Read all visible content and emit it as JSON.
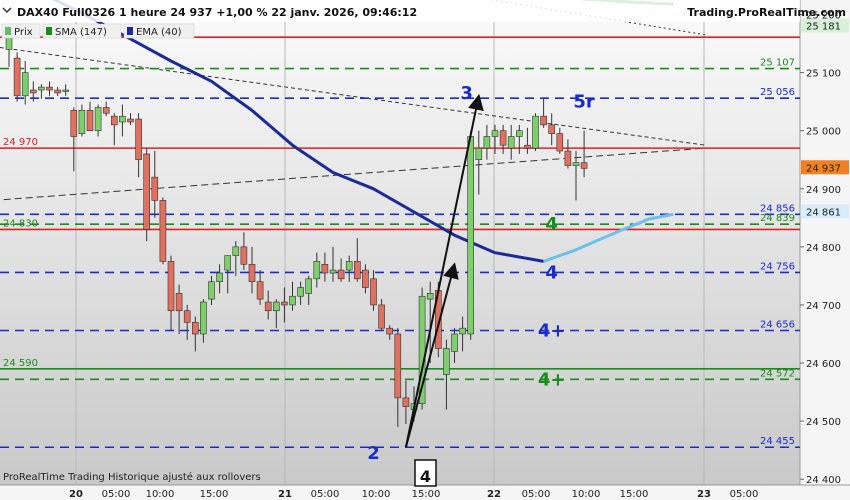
{
  "header": {
    "title": "DAX40 Full0326 1 heure 24 937 +1,00 % 22 janv. 2026, 09:46:12",
    "brand": "Trading.ProRealTime.com"
  },
  "legend": [
    {
      "label": "Prix",
      "color": "#66bb66"
    },
    {
      "label": "SMA (147)",
      "color": "#1a8c1a"
    },
    {
      "label": "EMA (40)",
      "color": "#1a2a99"
    }
  ],
  "footer": {
    "text": "ProRealTime Trading  Historique ajusté aux rollovers",
    "box_label": "4"
  },
  "chart_data": {
    "type": "candlestick",
    "timeframe": "1 heure",
    "ylim": [
      24390,
      25225
    ],
    "y_ticks": [
      "25 200",
      "25 100",
      "25 000",
      "24 900",
      "24 800",
      "24 700",
      "24 600",
      "24 500",
      "24 400"
    ],
    "y_tick_values": [
      25200,
      25100,
      25000,
      24900,
      24800,
      24700,
      24600,
      24500,
      24400
    ],
    "x_ticks": [
      "20",
      "05:00",
      "10:00",
      "15:00",
      "21",
      "05:00",
      "10:00",
      "15:00",
      "22",
      "05:00",
      "10:00",
      "15:00",
      "23",
      "05:00"
    ],
    "x_tick_bold": [
      true,
      false,
      false,
      false,
      true,
      false,
      false,
      false,
      true,
      false,
      false,
      false,
      true,
      false
    ],
    "candles": [
      {
        "o": 25140,
        "h": 25170,
        "l": 25110,
        "c": 25160
      },
      {
        "o": 25125,
        "h": 25135,
        "l": 25050,
        "c": 25060
      },
      {
        "o": 25060,
        "h": 25120,
        "l": 25045,
        "c": 25100
      },
      {
        "o": 25070,
        "h": 25085,
        "l": 25050,
        "c": 25065
      },
      {
        "o": 25070,
        "h": 25080,
        "l": 25055,
        "c": 25075
      },
      {
        "o": 25075,
        "h": 25085,
        "l": 25060,
        "c": 25070
      },
      {
        "o": 25070,
        "h": 25075,
        "l": 25060,
        "c": 25065
      },
      {
        "o": 25070,
        "h": 25080,
        "l": 25060,
        "c": 25070
      },
      {
        "o": 25035,
        "h": 25040,
        "l": 24930,
        "c": 24990
      },
      {
        "o": 24995,
        "h": 25045,
        "l": 24990,
        "c": 25035
      },
      {
        "o": 25035,
        "h": 25050,
        "l": 25000,
        "c": 25000
      },
      {
        "o": 25000,
        "h": 25045,
        "l": 24990,
        "c": 25040
      },
      {
        "o": 25040,
        "h": 25050,
        "l": 25025,
        "c": 25030
      },
      {
        "o": 25025,
        "h": 25030,
        "l": 24975,
        "c": 25010
      },
      {
        "o": 25015,
        "h": 25045,
        "l": 24990,
        "c": 25025
      },
      {
        "o": 25020,
        "h": 25030,
        "l": 25010,
        "c": 25015
      },
      {
        "o": 25020,
        "h": 25030,
        "l": 24920,
        "c": 24950
      },
      {
        "o": 24960,
        "h": 24970,
        "l": 24810,
        "c": 24830
      },
      {
        "o": 24920,
        "h": 24965,
        "l": 24850,
        "c": 24880
      },
      {
        "o": 24880,
        "h": 24885,
        "l": 24770,
        "c": 24775
      },
      {
        "o": 24775,
        "h": 24785,
        "l": 24655,
        "c": 24690
      },
      {
        "o": 24720,
        "h": 24735,
        "l": 24650,
        "c": 24690
      },
      {
        "o": 24690,
        "h": 24700,
        "l": 24640,
        "c": 24670
      },
      {
        "o": 24670,
        "h": 24680,
        "l": 24620,
        "c": 24650
      },
      {
        "o": 24650,
        "h": 24710,
        "l": 24635,
        "c": 24705
      },
      {
        "o": 24710,
        "h": 24750,
        "l": 24700,
        "c": 24740
      },
      {
        "o": 24740,
        "h": 24770,
        "l": 24720,
        "c": 24755
      },
      {
        "o": 24760,
        "h": 24785,
        "l": 24720,
        "c": 24785
      },
      {
        "o": 24785,
        "h": 24810,
        "l": 24750,
        "c": 24800
      },
      {
        "o": 24800,
        "h": 24825,
        "l": 24760,
        "c": 24770
      },
      {
        "o": 24770,
        "h": 24800,
        "l": 24720,
        "c": 24740
      },
      {
        "o": 24740,
        "h": 24760,
        "l": 24700,
        "c": 24710
      },
      {
        "o": 24705,
        "h": 24725,
        "l": 24675,
        "c": 24690
      },
      {
        "o": 24690,
        "h": 24710,
        "l": 24660,
        "c": 24705
      },
      {
        "o": 24705,
        "h": 24730,
        "l": 24670,
        "c": 24700
      },
      {
        "o": 24700,
        "h": 24740,
        "l": 24690,
        "c": 24715
      },
      {
        "o": 24715,
        "h": 24740,
        "l": 24700,
        "c": 24730
      },
      {
        "o": 24720,
        "h": 24750,
        "l": 24700,
        "c": 24745
      },
      {
        "o": 24745,
        "h": 24790,
        "l": 24730,
        "c": 24775
      },
      {
        "o": 24770,
        "h": 24790,
        "l": 24740,
        "c": 24755
      },
      {
        "o": 24755,
        "h": 24800,
        "l": 24740,
        "c": 24760
      },
      {
        "o": 24760,
        "h": 24780,
        "l": 24740,
        "c": 24745
      },
      {
        "o": 24760,
        "h": 24785,
        "l": 24740,
        "c": 24775
      },
      {
        "o": 24775,
        "h": 24815,
        "l": 24740,
        "c": 24745
      },
      {
        "o": 24760,
        "h": 24770,
        "l": 24720,
        "c": 24730
      },
      {
        "o": 24745,
        "h": 24760,
        "l": 24690,
        "c": 24700
      },
      {
        "o": 24700,
        "h": 24710,
        "l": 24655,
        "c": 24660
      },
      {
        "o": 24660,
        "h": 24665,
        "l": 24640,
        "c": 24650
      },
      {
        "o": 24650,
        "h": 24660,
        "l": 24490,
        "c": 24540
      },
      {
        "o": 24540,
        "h": 24570,
        "l": 24495,
        "c": 24525
      },
      {
        "o": 24520,
        "h": 24560,
        "l": 24500,
        "c": 24530
      },
      {
        "o": 24530,
        "h": 24730,
        "l": 24520,
        "c": 24715
      },
      {
        "o": 24710,
        "h": 24740,
        "l": 24600,
        "c": 24720
      },
      {
        "o": 24725,
        "h": 24740,
        "l": 24610,
        "c": 24625
      },
      {
        "o": 24580,
        "h": 24640,
        "l": 24520,
        "c": 24625
      },
      {
        "o": 24620,
        "h": 24660,
        "l": 24600,
        "c": 24650
      },
      {
        "o": 24650,
        "h": 24680,
        "l": 24620,
        "c": 24660
      },
      {
        "o": 24650,
        "h": 25000,
        "l": 24640,
        "c": 24990
      },
      {
        "o": 24950,
        "h": 25000,
        "l": 24890,
        "c": 24970
      },
      {
        "o": 24970,
        "h": 25010,
        "l": 24950,
        "c": 24990
      },
      {
        "o": 24990,
        "h": 25010,
        "l": 24960,
        "c": 25000
      },
      {
        "o": 25000,
        "h": 25010,
        "l": 24960,
        "c": 24975
      },
      {
        "o": 24970,
        "h": 25010,
        "l": 24950,
        "c": 24990
      },
      {
        "o": 24990,
        "h": 25010,
        "l": 24960,
        "c": 25000
      },
      {
        "o": 24975,
        "h": 25005,
        "l": 24960,
        "c": 24970
      },
      {
        "o": 24970,
        "h": 25030,
        "l": 24965,
        "c": 25025
      },
      {
        "o": 25025,
        "h": 25055,
        "l": 25005,
        "c": 25010
      },
      {
        "o": 25010,
        "h": 25030,
        "l": 24975,
        "c": 24995
      },
      {
        "o": 24995,
        "h": 25005,
        "l": 24960,
        "c": 24965
      },
      {
        "o": 24965,
        "h": 24985,
        "l": 24935,
        "c": 24940
      },
      {
        "o": 24940,
        "h": 24965,
        "l": 24880,
        "c": 24945
      },
      {
        "o": 24945,
        "h": 25000,
        "l": 24920,
        "c": 24935
      }
    ],
    "series": [
      {
        "name": "SMA (147)",
        "color": "#1a8c1a",
        "points": [
          [
            45,
            25270
          ],
          [
            55,
            25245
          ],
          [
            60,
            25236
          ],
          [
            65,
            25232
          ],
          [
            70,
            25228
          ],
          [
            76,
            25222
          ],
          [
            82,
            25218
          ]
        ]
      },
      {
        "name": "EMA (40)",
        "color": "#1a2a99",
        "points": [
          [
            0,
            25250
          ],
          [
            5,
            25230
          ],
          [
            10,
            25195
          ],
          [
            15,
            25158
          ],
          [
            20,
            25120
          ],
          [
            25,
            25085
          ],
          [
            30,
            25035
          ],
          [
            35,
            24975
          ],
          [
            40,
            24928
          ],
          [
            45,
            24900
          ],
          [
            50,
            24860
          ],
          [
            55,
            24820
          ],
          [
            60,
            24790
          ],
          [
            66,
            24775
          ]
        ]
      },
      {
        "color": "#6bc0ee",
        "points": [
          [
            66,
            24775
          ],
          [
            70,
            24795
          ],
          [
            75,
            24825
          ],
          [
            79,
            24848
          ],
          [
            82,
            24856
          ]
        ]
      }
    ],
    "levels": [
      {
        "value": 25161,
        "label": "25 161",
        "color": "#e02020",
        "style": "solid",
        "label_side": "left"
      },
      {
        "value": 24970,
        "label": "24 970",
        "color": "#e02020",
        "style": "solid",
        "label_side": "left"
      },
      {
        "value": 24830,
        "label": "24 830",
        "color": "#e02020",
        "style": "solid",
        "label_side": "left",
        "label_color": "#1a8c1a"
      },
      {
        "value": 24590,
        "label": "24 590",
        "color": "#1a8c1a",
        "style": "solid",
        "label_side": "left"
      },
      {
        "value": 25107,
        "label": "25 107",
        "color": "#1a8c1a",
        "style": "dashed",
        "label_side": "right"
      },
      {
        "value": 25056,
        "label": "25 056",
        "color": "#1a2acc",
        "style": "dashed",
        "label_side": "right"
      },
      {
        "value": 24856,
        "label": "24 856",
        "color": "#1a2acc",
        "style": "dashed",
        "label_side": "right"
      },
      {
        "value": 24839,
        "label": "24 839",
        "color": "#1a8c1a",
        "style": "dashed",
        "label_side": "right"
      },
      {
        "value": 24756,
        "label": "24 756",
        "color": "#1a2acc",
        "style": "dashed",
        "label_side": "right"
      },
      {
        "value": 24656,
        "label": "24 656",
        "color": "#1a2acc",
        "style": "dashed",
        "label_side": "right"
      },
      {
        "value": 24572,
        "label": "24 572",
        "color": "#1a8c1a",
        "style": "dashed",
        "label_side": "right"
      },
      {
        "value": 24455,
        "label": "24 455",
        "color": "#1a2acc",
        "style": "dashed",
        "label_side": "right"
      }
    ],
    "axis_boxes": [
      {
        "value": 25181,
        "label": "25 181",
        "bg": "#d8f0d8",
        "fg": "#1a8c1a"
      },
      {
        "value": 24937,
        "label": "24 937",
        "bg": "#f08020",
        "fg": "#111111"
      },
      {
        "value": 24861,
        "label": "24 861",
        "bg": "#d8ecfa",
        "fg": "#1a2acc"
      }
    ],
    "trend_lines": [
      {
        "from": [
          -2,
          25145
        ],
        "to": [
          86,
          24975
        ],
        "color": "#333333",
        "dash": "4,3",
        "width": 1
      },
      {
        "from": [
          -2,
          24880
        ],
        "to": [
          86,
          24970
        ],
        "color": "#333333",
        "dash": "7,4",
        "width": 1
      },
      {
        "from": [
          40,
          25270
        ],
        "to": [
          86,
          25165
        ],
        "color": "#333333",
        "dash": "2,3",
        "width": 1
      }
    ],
    "arrows": [
      {
        "from": [
          49,
          24455
        ],
        "to": [
          58,
          25060
        ]
      },
      {
        "from": [
          49,
          24455
        ],
        "to": [
          55,
          24770
        ]
      }
    ],
    "annotations": [
      {
        "text": "3",
        "x": 56.5,
        "y": 25065,
        "color": "#1a2acc",
        "size": 18
      },
      {
        "text": "5r",
        "x": 71,
        "y": 25050,
        "color": "#1a2acc",
        "size": 18
      },
      {
        "text": "4",
        "x": 67,
        "y": 24839,
        "color": "#1a8c1a",
        "size": 18
      },
      {
        "text": "4",
        "x": 67,
        "y": 24756,
        "color": "#1a2acc",
        "size": 18
      },
      {
        "text": "4+",
        "x": 67,
        "y": 24656,
        "color": "#1a2acc",
        "size": 18
      },
      {
        "text": "4+",
        "x": 67,
        "y": 24572,
        "color": "#1a8c1a",
        "size": 18
      },
      {
        "text": "2",
        "x": 45,
        "y": 24445,
        "color": "#1a2acc",
        "size": 18
      }
    ]
  }
}
